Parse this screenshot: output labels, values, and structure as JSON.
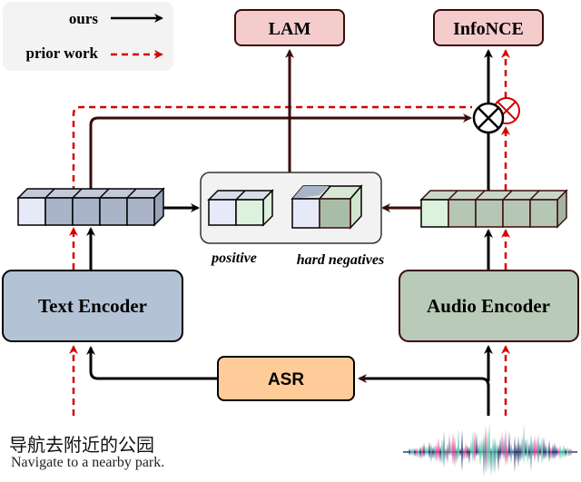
{
  "legend": {
    "ours_label": "ours",
    "prior_label": "prior work",
    "ours_color": "#000000",
    "prior_color": "#d40000"
  },
  "boxes": {
    "lam": "LAM",
    "infonce": "InfoNCE",
    "text_encoder": "Text Encoder",
    "audio_encoder": "Audio Encoder",
    "asr": "ASR"
  },
  "pair_panel": {
    "positive_label": "positive",
    "hard_negatives_label": "hard negatives"
  },
  "input": {
    "text_cn": "导航去附近的公园",
    "text_en": "Navigate to a nearby park."
  },
  "colors": {
    "loss_fill": "#f4cccc",
    "text_encoder_fill": "#b4c2d6",
    "audio_encoder_fill": "#b9cbb8",
    "asr_fill": "#ffcc99",
    "text_token": "#a9b4c9",
    "text_token_first": "#e6e9f7",
    "audio_token": "#b5c7b4",
    "audio_token_first": "#ddf2dd",
    "dark_arrow": "#3a0b0b",
    "panel_fill": "#f2f2f2"
  },
  "icons": {
    "multiply": "circled-times-icon",
    "waveform": "audio-waveform-icon"
  }
}
